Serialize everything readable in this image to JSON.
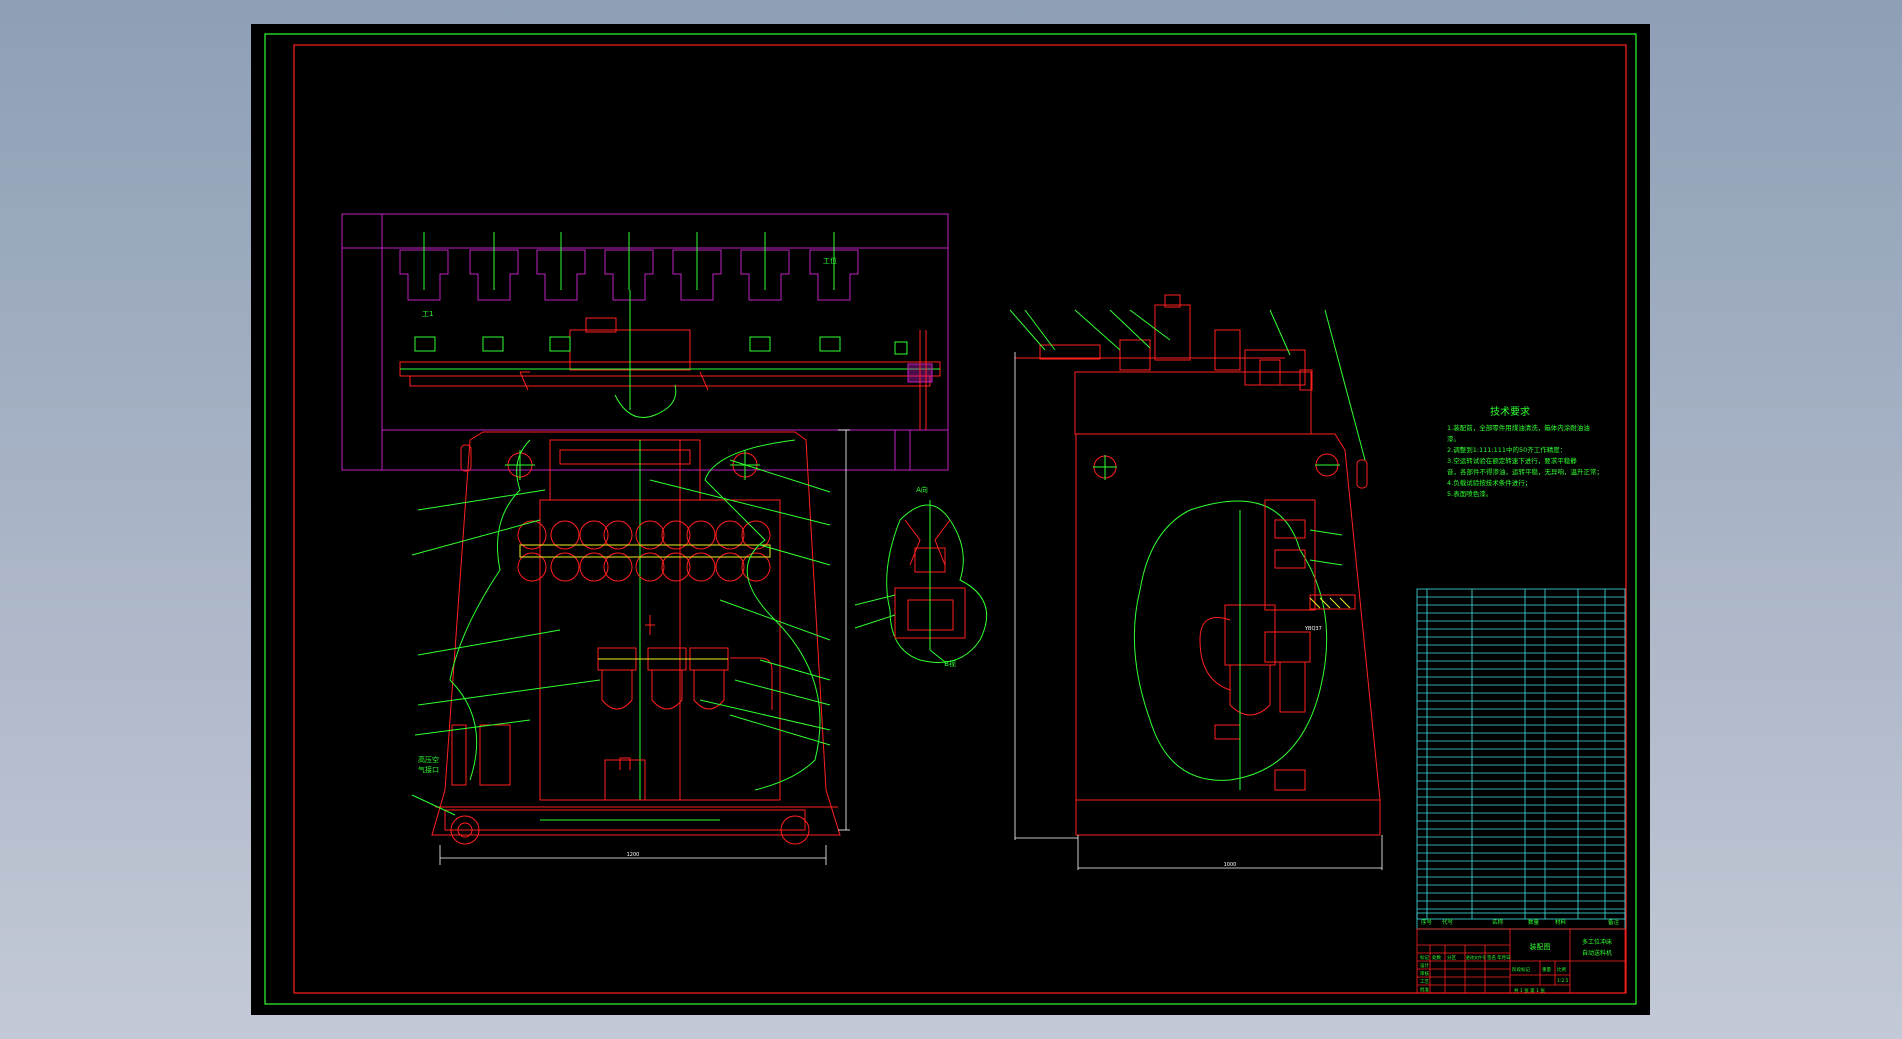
{
  "viewer": {
    "background_top": "#8e9fb6",
    "background_bottom": "#c3c9d6",
    "canvas_color": "#000000"
  },
  "colors": {
    "red": "#ff2020",
    "green": "#30ff30",
    "magenta": "#c020c0",
    "cyan": "#40e0e0",
    "white": "#ffffff",
    "yellow": "#f0f020"
  },
  "drawing": {
    "tech_requirements": {
      "title": "技术要求",
      "lines": [
        "1.装配前，全部零件用煤油清洗，箱体内涂耐油油",
        "漆。",
        "2.调整到1:111:111中的50齐工作精度：",
        "3.空运转试验在额定转速下进行，要求平稳静",
        "音，各部件不得渗油，运转平稳，无异响，温升正常；",
        "4.负载试验按技术条件进行；",
        "5.表面喷色漆。"
      ]
    },
    "labels": {
      "station_tag": "工位",
      "detail_top": "A向",
      "detail_bottom": "B视",
      "air_inlet_1": "高压空",
      "air_inlet_2": "气接口",
      "dim_front": "1200",
      "dim_side": "1000",
      "valve_label": "YBQ37",
      "left_tag": "工1"
    },
    "title_block": {
      "drawing_name": "装配图",
      "part_name_1": "多工位冲床",
      "part_name_2": "自动送料机",
      "header_cols": [
        "序号",
        "代号",
        "名称",
        "数量",
        "材料",
        "备注"
      ],
      "mark_cols": [
        "标记",
        "处数",
        "分区",
        "更改文件号",
        "签名",
        "年月日"
      ],
      "roles": [
        "设计",
        "审核",
        "工艺",
        "批准"
      ],
      "stage_labels": [
        "阶段标记",
        "重量",
        "比例"
      ],
      "scale": "1:2.5",
      "sheet_info": "共 1 张  第 1 张"
    }
  }
}
